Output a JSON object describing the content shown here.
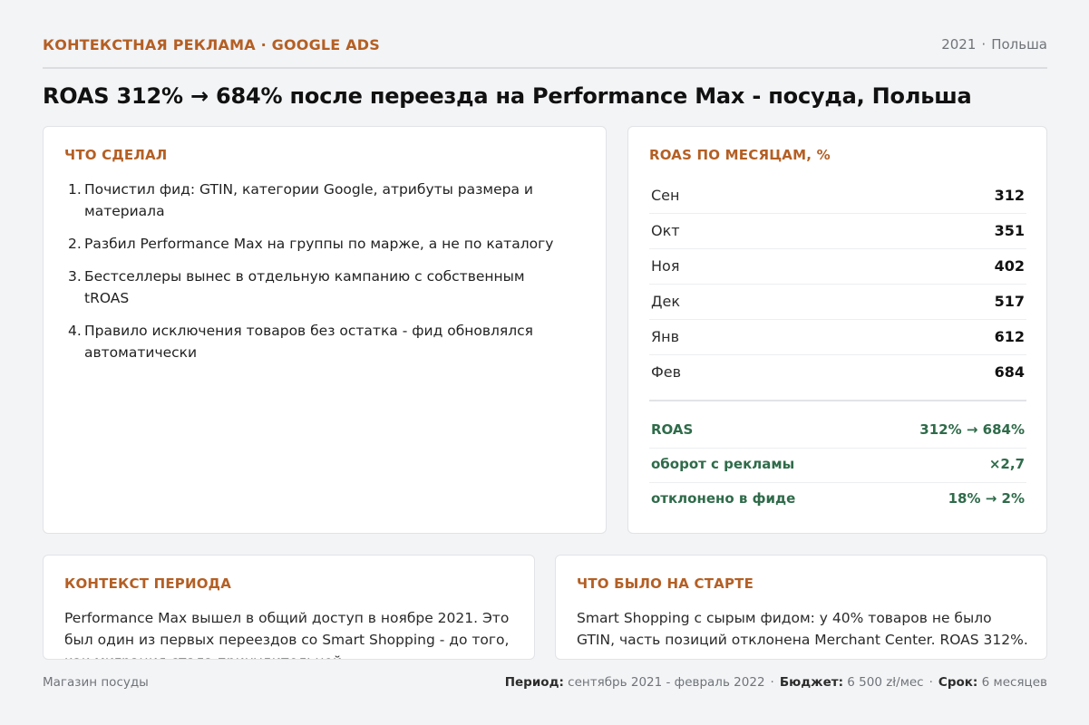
{
  "header": {
    "eyebrow": "КОНТЕКСТНАЯ РЕКЛАМА · GOOGLE ADS",
    "year": "2021",
    "separator": "·",
    "country": "Польша"
  },
  "title": "ROAS 312% → 684% после переезда на Performance Max - посуда, Польша",
  "actions": {
    "title": "ЧТО СДЕЛАЛ",
    "items": [
      {
        "num": "1.",
        "text": "Почистил фид: GTIN, категории Google, атрибуты размера и материала"
      },
      {
        "num": "2.",
        "text": "Разбил Performance Max на группы по марже, а не по каталогу"
      },
      {
        "num": "3.",
        "text": "Бестселлеры вынес в отдельную кампанию с собственным tROAS"
      },
      {
        "num": "4.",
        "text": "Правило исключения товаров без остатка - фид обновлялся автоматически"
      }
    ]
  },
  "roas": {
    "title": "ROAS ПО МЕСЯЦАМ, %",
    "months": [
      {
        "month": "Сен",
        "value": "312"
      },
      {
        "month": "Окт",
        "value": "351"
      },
      {
        "month": "Ноя",
        "value": "402"
      },
      {
        "month": "Дек",
        "value": "517"
      },
      {
        "month": "Янв",
        "value": "612"
      },
      {
        "month": "Фев",
        "value": "684"
      }
    ],
    "summary": [
      {
        "label": "ROAS",
        "value": "312% → 684%"
      },
      {
        "label": "оборот с рекламы",
        "value": "×2,7"
      },
      {
        "label": "отклонено в фиде",
        "value": "18% → 2%"
      }
    ]
  },
  "context": {
    "title": "КОНТЕКСТ ПЕРИОДА",
    "text": "Performance Max вышел в общий доступ в ноябре 2021. Это был один из первых переездов со Smart Shopping - до того, как миграция стала принудительной."
  },
  "start": {
    "title": "ЧТО БЫЛО НА СТАРТЕ",
    "text": "Smart Shopping с сырым фидом: у 40% товаров не было GTIN, часть позиций отклонена Merchant Center. ROAS 312%."
  },
  "footer": {
    "client": "Магазин посуды",
    "period_label": "Период:",
    "period_value": "сентябрь 2021 - февраль 2022",
    "budget_label": "Бюджет:",
    "budget_value": "6 500 zł/мес",
    "term_label": "Срок:",
    "term_value": "6 месяцев",
    "separator": "·"
  }
}
